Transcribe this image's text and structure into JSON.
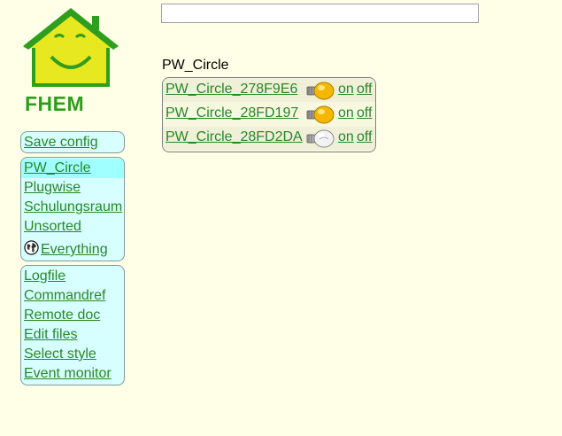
{
  "logo": {
    "text": "FHEM",
    "icon": "fhem-house-logo"
  },
  "search": {
    "value": "",
    "placeholder": ""
  },
  "menu": {
    "top": [
      {
        "label": "Save config"
      }
    ],
    "rooms": [
      {
        "label": "PW_Circle",
        "selected": true
      },
      {
        "label": "Plugwise"
      },
      {
        "label": "Schulungsraum"
      },
      {
        "label": "Unsorted"
      },
      {
        "label": "Everything",
        "icon": "globe-icon"
      }
    ],
    "tools": [
      {
        "label": "Logfile"
      },
      {
        "label": "Commandref"
      },
      {
        "label": "Remote doc"
      },
      {
        "label": "Edit files"
      },
      {
        "label": "Select style"
      },
      {
        "label": "Event monitor"
      }
    ]
  },
  "room": {
    "title": "PW_Circle",
    "devices": [
      {
        "name": "PW_Circle_278F9E6",
        "state_icon": "bulb-on-icon",
        "on": "on",
        "off": "off"
      },
      {
        "name": "PW_Circle_28FD197",
        "state_icon": "bulb-on-icon",
        "on": "on",
        "off": "off"
      },
      {
        "name": "PW_Circle_28FD2DA",
        "state_icon": "bulb-off-icon",
        "on": "on",
        "off": "off"
      }
    ]
  },
  "colors": {
    "background": "#FFFFE7",
    "link": "#278727",
    "menu_bg": "#D7FFFF",
    "menu_selected": "#A0FFFF",
    "logo_green": "#2E9E1E",
    "logo_yellow": "#E8E820"
  }
}
